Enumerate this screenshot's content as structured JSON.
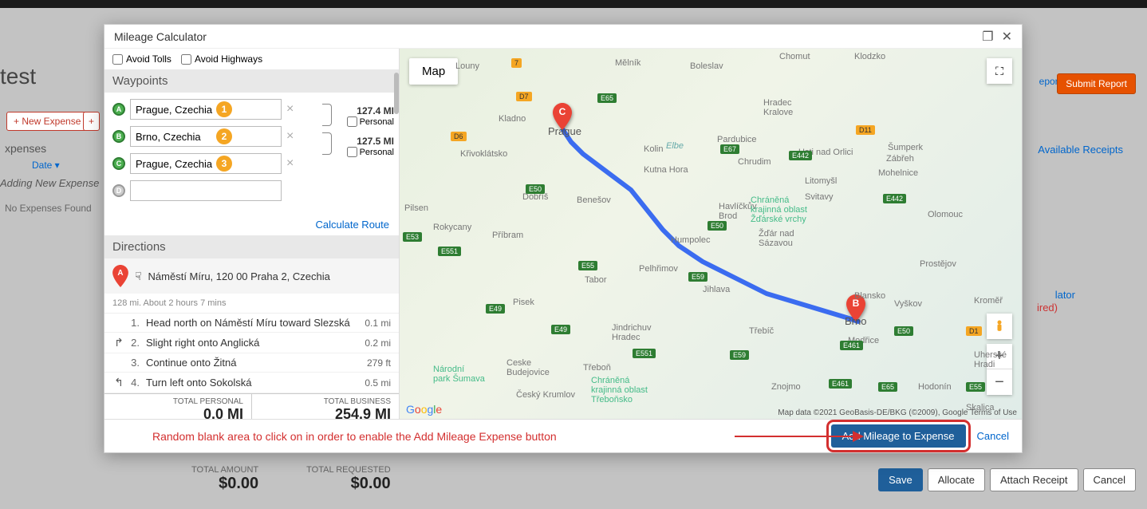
{
  "bg": {
    "title": "test",
    "copyReport": "eport",
    "submitReport": "Submit Report",
    "newExpense": "+  New Expense",
    "plus": "+",
    "expensesLabel": "xpenses",
    "dateHeader": "Date ▾",
    "adding": "Adding New Expense",
    "noExpenses": "No Expenses Found",
    "availReceipts": "Available Receipts",
    "rightLator": "lator",
    "rightIred": "ired)",
    "totalAmountLabel": "TOTAL AMOUNT",
    "totalAmountVal": "$0.00",
    "totalRequestedLabel": "TOTAL REQUESTED",
    "totalRequestedVal": "$0.00",
    "save": "Save",
    "allocate": "Allocate",
    "attach": "Attach Receipt",
    "cancel": "Cancel"
  },
  "modal": {
    "title": "Mileage Calculator",
    "avoidTolls": "Avoid Tolls",
    "avoidHighways": "Avoid Highways",
    "waypointsHeader": "Waypoints",
    "wpA": "Prague, Czechia",
    "wpB": "Brno, Czechia",
    "wpC": "Prague, Czechia",
    "wpD": "",
    "badge1": "1",
    "badge2": "2",
    "badge3": "3",
    "seg1miles": "127.4 MI",
    "seg2miles": "127.5 MI",
    "personal": "Personal",
    "calcRoute": "Calculate Route",
    "directionsHeader": "Directions",
    "dirStart": "Náměstí Míru, 120 00 Praha 2, Czechia",
    "dirSummary": "128 mi. About 2 hours 7 mins",
    "steps": [
      {
        "n": "1.",
        "turn": "",
        "desc": "Head north on Náměstí Míru toward Slezská",
        "dist": "0.1 mi"
      },
      {
        "n": "2.",
        "turn": "↱",
        "desc": "Slight right onto Anglická",
        "dist": "0.2 mi"
      },
      {
        "n": "3.",
        "turn": "",
        "desc": "Continue onto Žitná",
        "dist": "279 ft"
      },
      {
        "n": "4.",
        "turn": "↰",
        "desc": "Turn left onto Sokolská",
        "dist": "0.5 mi"
      }
    ],
    "totalPersonalLbl": "TOTAL PERSONAL",
    "totalPersonalVal": "0.0 MI",
    "totalBusinessLbl": "TOTAL BUSINESS",
    "totalBusinessVal": "254.9 MI"
  },
  "map": {
    "mapBtn": "Map",
    "cities": {
      "prague": "Prague",
      "brno": "Brno",
      "pilsen": "Pilsen",
      "boleslav": "Boleslav",
      "kladno": "Kladno",
      "kolin": "Kolin",
      "kutna": "Kutna Hora",
      "pardubice": "Pardubice",
      "hk": "Hradec\nKralove",
      "chrudim": "Chrudim",
      "usti": "Usti nad Orlici",
      "sumperk": "Šumperk",
      "svitavy": "Svitavy",
      "litomysl": "Litomyšl",
      "zabreh": "Zábřeh",
      "krivo": "Křivoklátsko",
      "rokycany": "Rokycany",
      "pribram": "Příbram",
      "dobris": "Dobříš",
      "benesov": "Benešov",
      "tabor": "Tabor",
      "pisek": "Pisek",
      "cb": "Ceske\nBudejovice",
      "trebon": "Třeboň",
      "jh": "Jindrichuv\nHradec",
      "pelhrimov": "Pelhřimov",
      "humpolec": "Humpolec",
      "jihlava": "Jihlava",
      "hbrod": "Havlíčkův\nBrod",
      "zdar": "Žďár nad\nSázavou",
      "trebic": "Třebíč",
      "znojmo": "Znojmo",
      "blansko": "Blansko",
      "vyskov": "Vyškov",
      "prostejov": "Prostějov",
      "olomouc": "Olomouc",
      "mohelnice": "Mohelnice",
      "chranena": "Chráněná\nkrajinná oblast\nŽďárské vrchy",
      "chranena2": "Chráněná\nkrajinná oblast\nTřeboňsko",
      "narodni": "Národní\npark Šumava",
      "cesky": "Český Krumlov",
      "modrice": "Modřice",
      "hodonin": "Hodonín",
      "uh": "Uherské\nHradi",
      "kromer": "Kroměř",
      "chomut": "Chomut",
      "elbe": "Elbe",
      "skalica": "Skalica"
    },
    "attr": "Map data ©2021 GeoBasis-DE/BKG (©2009), Google   Terms of Use"
  },
  "footer": {
    "note": "Random blank area to click on in order to enable the Add Mileage Expense button",
    "addBtn": "Add Mileage to Expense",
    "cancel": "Cancel"
  }
}
